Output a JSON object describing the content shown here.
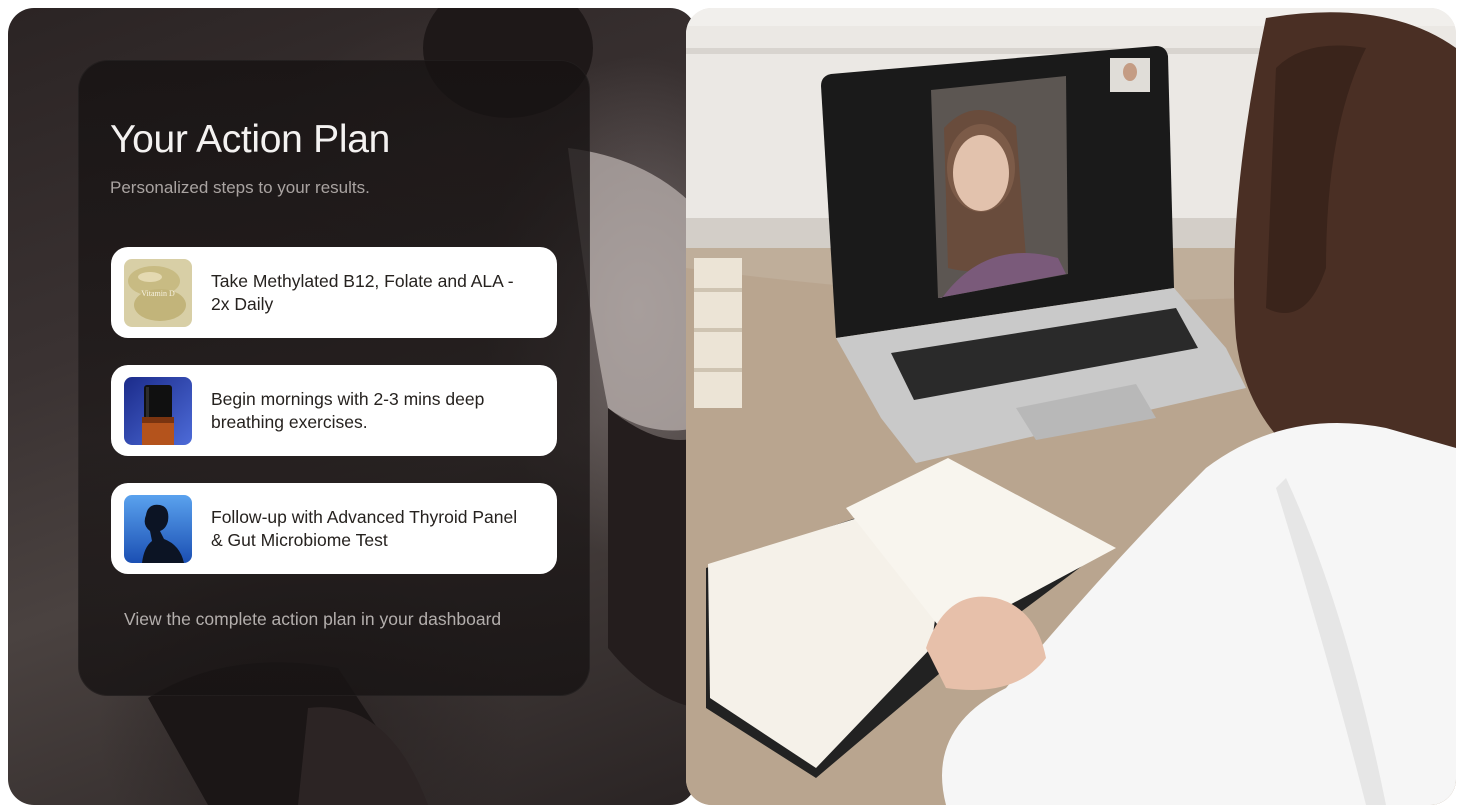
{
  "action_plan": {
    "title": "Your Action Plan",
    "subtitle": "Personalized steps to your results.",
    "steps": [
      {
        "text": "Take Methylated B12, Folate and ALA - 2x Daily",
        "icon": "supplement-capsule-icon",
        "thumb_label": "Vitamin D"
      },
      {
        "text": "Begin mornings with 2-3 mins deep breathing exercises.",
        "icon": "dropper-bottle-icon"
      },
      {
        "text": "Follow-up with Advanced Thyroid Panel & Gut Microbiome Test",
        "icon": "person-silhouette-icon"
      }
    ],
    "footer_link": "View the complete action plan in your dashboard"
  },
  "colors": {
    "card_bg": "#1c1717",
    "step_bg": "#ffffff",
    "title": "#f4f2f1",
    "subtitle": "#a9a3a1"
  },
  "scene": {
    "description_icon": "video-call-laptop-icon"
  }
}
